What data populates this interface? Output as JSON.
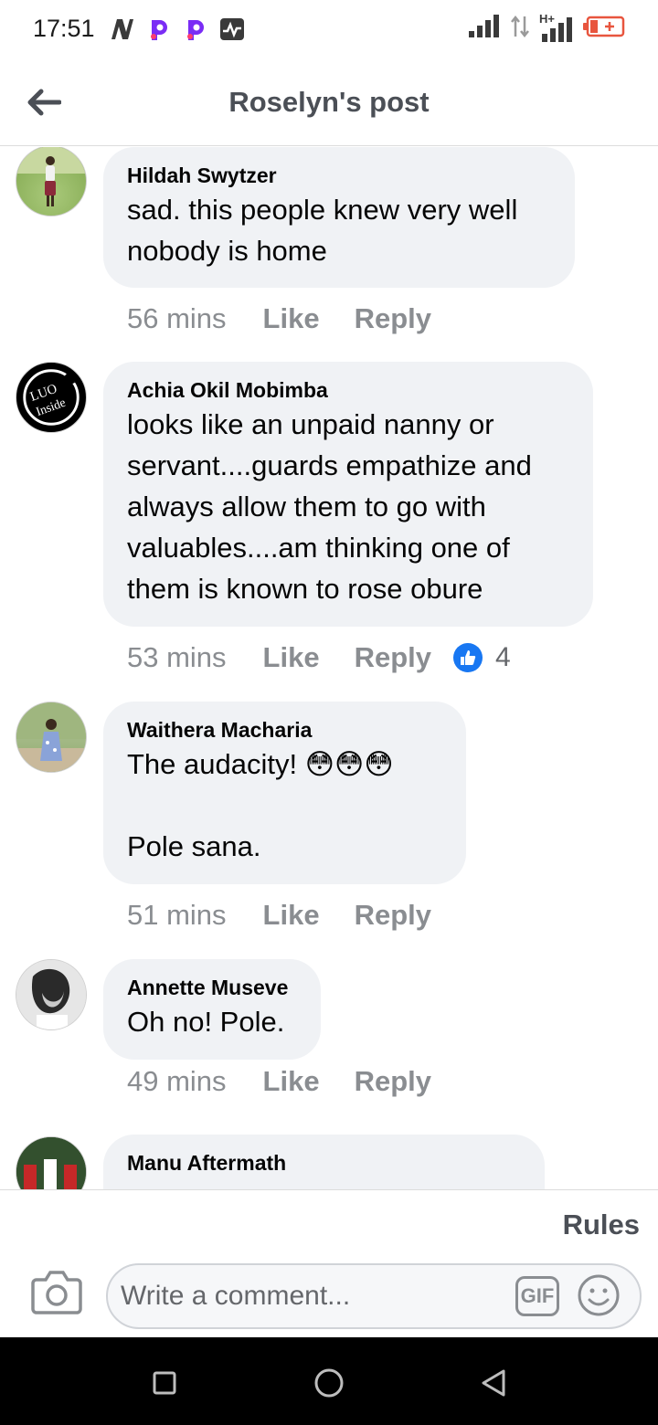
{
  "status_bar": {
    "time": "17:51",
    "left_icons": [
      "n-app-icon",
      "p-app-icon",
      "p-app-icon",
      "activity-icon"
    ],
    "right_icons": [
      "signal-icon",
      "data-arrows-icon",
      "signal-hplus-icon",
      "battery-icon"
    ],
    "network_label": "H+"
  },
  "header": {
    "title": "Roselyn's post"
  },
  "comments": [
    {
      "author": "Hildah Swytzer",
      "text": "sad. this people knew very well\nnobody is home",
      "time": "56 mins",
      "like_label": "Like",
      "reply_label": "Reply"
    },
    {
      "author": "Achia Okil Mobimba",
      "text": "looks like an unpaid nanny or\nservant....guards empathize and\nalways allow them to go with\nvaluables....am thinking one of\nthem is known to rose obure",
      "time": "53 mins",
      "like_label": "Like",
      "reply_label": "Reply",
      "reaction_count": "4",
      "avatar_text_top": "LUO",
      "avatar_text_bottom": "Inside"
    },
    {
      "author": "Waithera Macharia",
      "text": "The audacity! 😳😳😳\n\nPole sana.",
      "time": "51 mins",
      "like_label": "Like",
      "reply_label": "Reply"
    },
    {
      "author": "Annette Museve",
      "text": "Oh no! Pole.",
      "time": "49 mins",
      "like_label": "Like",
      "reply_label": "Reply"
    },
    {
      "author": "Manu Aftermath"
    }
  ],
  "composer": {
    "rules_label": "Rules",
    "placeholder": "Write a comment...",
    "gif_label": "GIF"
  },
  "colors": {
    "bubble": "#f0f2f5",
    "meta_text": "#8a8d91",
    "like_blue": "#1877f2",
    "header_title": "#4b4f56"
  }
}
